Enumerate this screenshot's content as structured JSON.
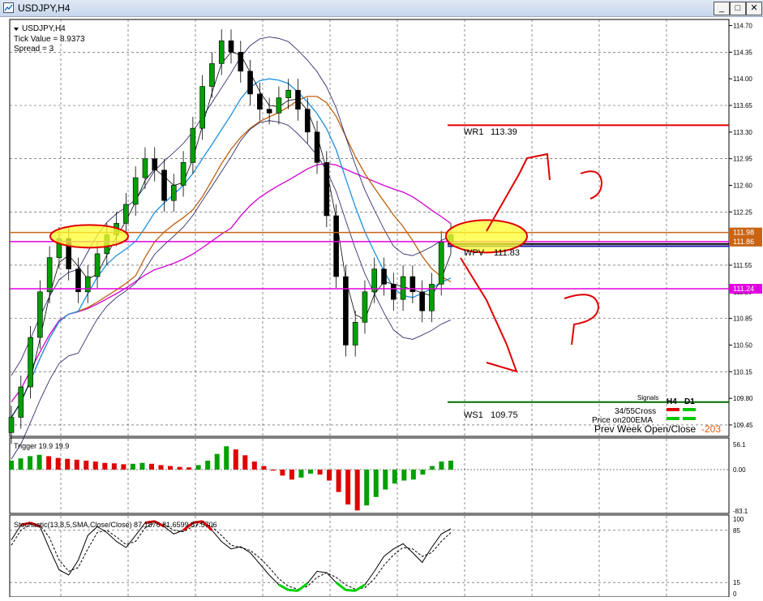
{
  "window": {
    "title": "USDJPY,H4",
    "buttons": {
      "minimize": "_",
      "maximize": "□",
      "close": "✕"
    }
  },
  "info": {
    "symbol_line": "USDJPY,H4",
    "tick_value": "Tick Value = 8.9373",
    "spread": "Spread = 3"
  },
  "price_axis": {
    "ticks": [
      "114.70",
      "114.35",
      "114.00",
      "113.65",
      "113.30",
      "112.95",
      "112.60",
      "112.25",
      "111.90",
      "111.55",
      "111.20",
      "110.85",
      "110.50",
      "110.15",
      "109.80",
      "109.45"
    ],
    "badges": [
      {
        "label": "111.98",
        "color": "#c86414"
      },
      {
        "label": "111.86",
        "color": "#c86414"
      },
      {
        "label": "111.24",
        "color": "#e000e0"
      }
    ]
  },
  "levels": {
    "wr1": {
      "name": "WR1",
      "value": "113.39",
      "color": "#e00000"
    },
    "wpv": {
      "name": "WPV",
      "value": "111.83",
      "color": "#000000"
    },
    "ws1": {
      "name": "WS1",
      "value": "109.75",
      "color": "#006e00"
    }
  },
  "signals": {
    "header": "Signals",
    "col_h4": "H4",
    "col_d1": "D1",
    "rows": [
      {
        "label": "34/55Cross",
        "h4": "#e00000",
        "d1": "#00c800"
      },
      {
        "label": "Price on200EMA",
        "h4": "#00c800",
        "d1": "#00c800"
      }
    ],
    "prev_week_label": "Prev Week Open/Close",
    "prev_week_value": "-203"
  },
  "trigger": {
    "title": "Trigger 19.9 19.9",
    "ticks": [
      "56.1",
      "0.00",
      "-83.1"
    ]
  },
  "stoch": {
    "title": "Stochastic(13,8,5,SMA,Close/Close) 87.1876 81.6599 87.5706",
    "ticks": [
      "100",
      "85",
      "15",
      "0"
    ]
  },
  "chart_data": [
    {
      "type": "line",
      "title": "USDJPY,H4",
      "ylim": [
        109.3,
        114.78
      ],
      "grid": true,
      "series": [
        {
          "name": "Close",
          "values": [
            109.55,
            109.95,
            110.6,
            111.2,
            111.65,
            111.9,
            111.5,
            111.2,
            111.4,
            111.7,
            111.95,
            112.1,
            112.35,
            112.7,
            112.95,
            112.8,
            112.4,
            112.6,
            112.9,
            113.35,
            113.9,
            114.2,
            114.5,
            114.35,
            114.1,
            113.8,
            113.6,
            113.55,
            113.75,
            113.85,
            113.6,
            113.3,
            112.9,
            112.2,
            111.4,
            110.5,
            110.8,
            111.2,
            111.5,
            111.3,
            111.1,
            111.4,
            111.2,
            110.95,
            111.3,
            111.85,
            111.95
          ]
        }
      ],
      "levels": [
        {
          "name": "WR1",
          "value": 113.39
        },
        {
          "name": "WPV",
          "value": 111.83
        },
        {
          "name": "WS1",
          "value": 109.75
        }
      ]
    },
    {
      "type": "bar",
      "title": "Trigger 19.9 19.9",
      "ylim": [
        -83.1,
        56.1
      ],
      "values": [
        20,
        25,
        30,
        33,
        30,
        26,
        24,
        22,
        20,
        18,
        15,
        14,
        12,
        13,
        15,
        13,
        10,
        8,
        6,
        5,
        10,
        20,
        35,
        52,
        45,
        32,
        18,
        8,
        -2,
        -12,
        -20,
        -16,
        -8,
        -10,
        -22,
        -45,
        -70,
        -82,
        -72,
        -55,
        -40,
        -28,
        -22,
        -20,
        -10,
        8,
        18,
        20
      ]
    },
    {
      "type": "line",
      "title": "Stochastic(13,8,5,SMA,Close/Close)",
      "ylim": [
        0,
        100
      ],
      "series": [
        {
          "name": "Main",
          "values": [
            72,
            92,
            95,
            90,
            60,
            32,
            25,
            45,
            78,
            90,
            82,
            70,
            62,
            78,
            95,
            97,
            90,
            80,
            85,
            95,
            97,
            85,
            70,
            60,
            63,
            55,
            40,
            25,
            12,
            5,
            4,
            14,
            30,
            28,
            15,
            5,
            4,
            12,
            30,
            50,
            60,
            67,
            55,
            42,
            62,
            80,
            87
          ]
        },
        {
          "name": "Signal",
          "values": [
            65,
            85,
            93,
            92,
            75,
            45,
            30,
            35,
            60,
            82,
            85,
            76,
            66,
            70,
            88,
            95,
            93,
            85,
            83,
            90,
            95,
            90,
            78,
            65,
            62,
            58,
            48,
            35,
            20,
            10,
            6,
            10,
            22,
            28,
            22,
            12,
            6,
            8,
            20,
            38,
            52,
            62,
            60,
            50,
            55,
            70,
            82
          ]
        }
      ],
      "levels": [
        85,
        15
      ]
    }
  ]
}
